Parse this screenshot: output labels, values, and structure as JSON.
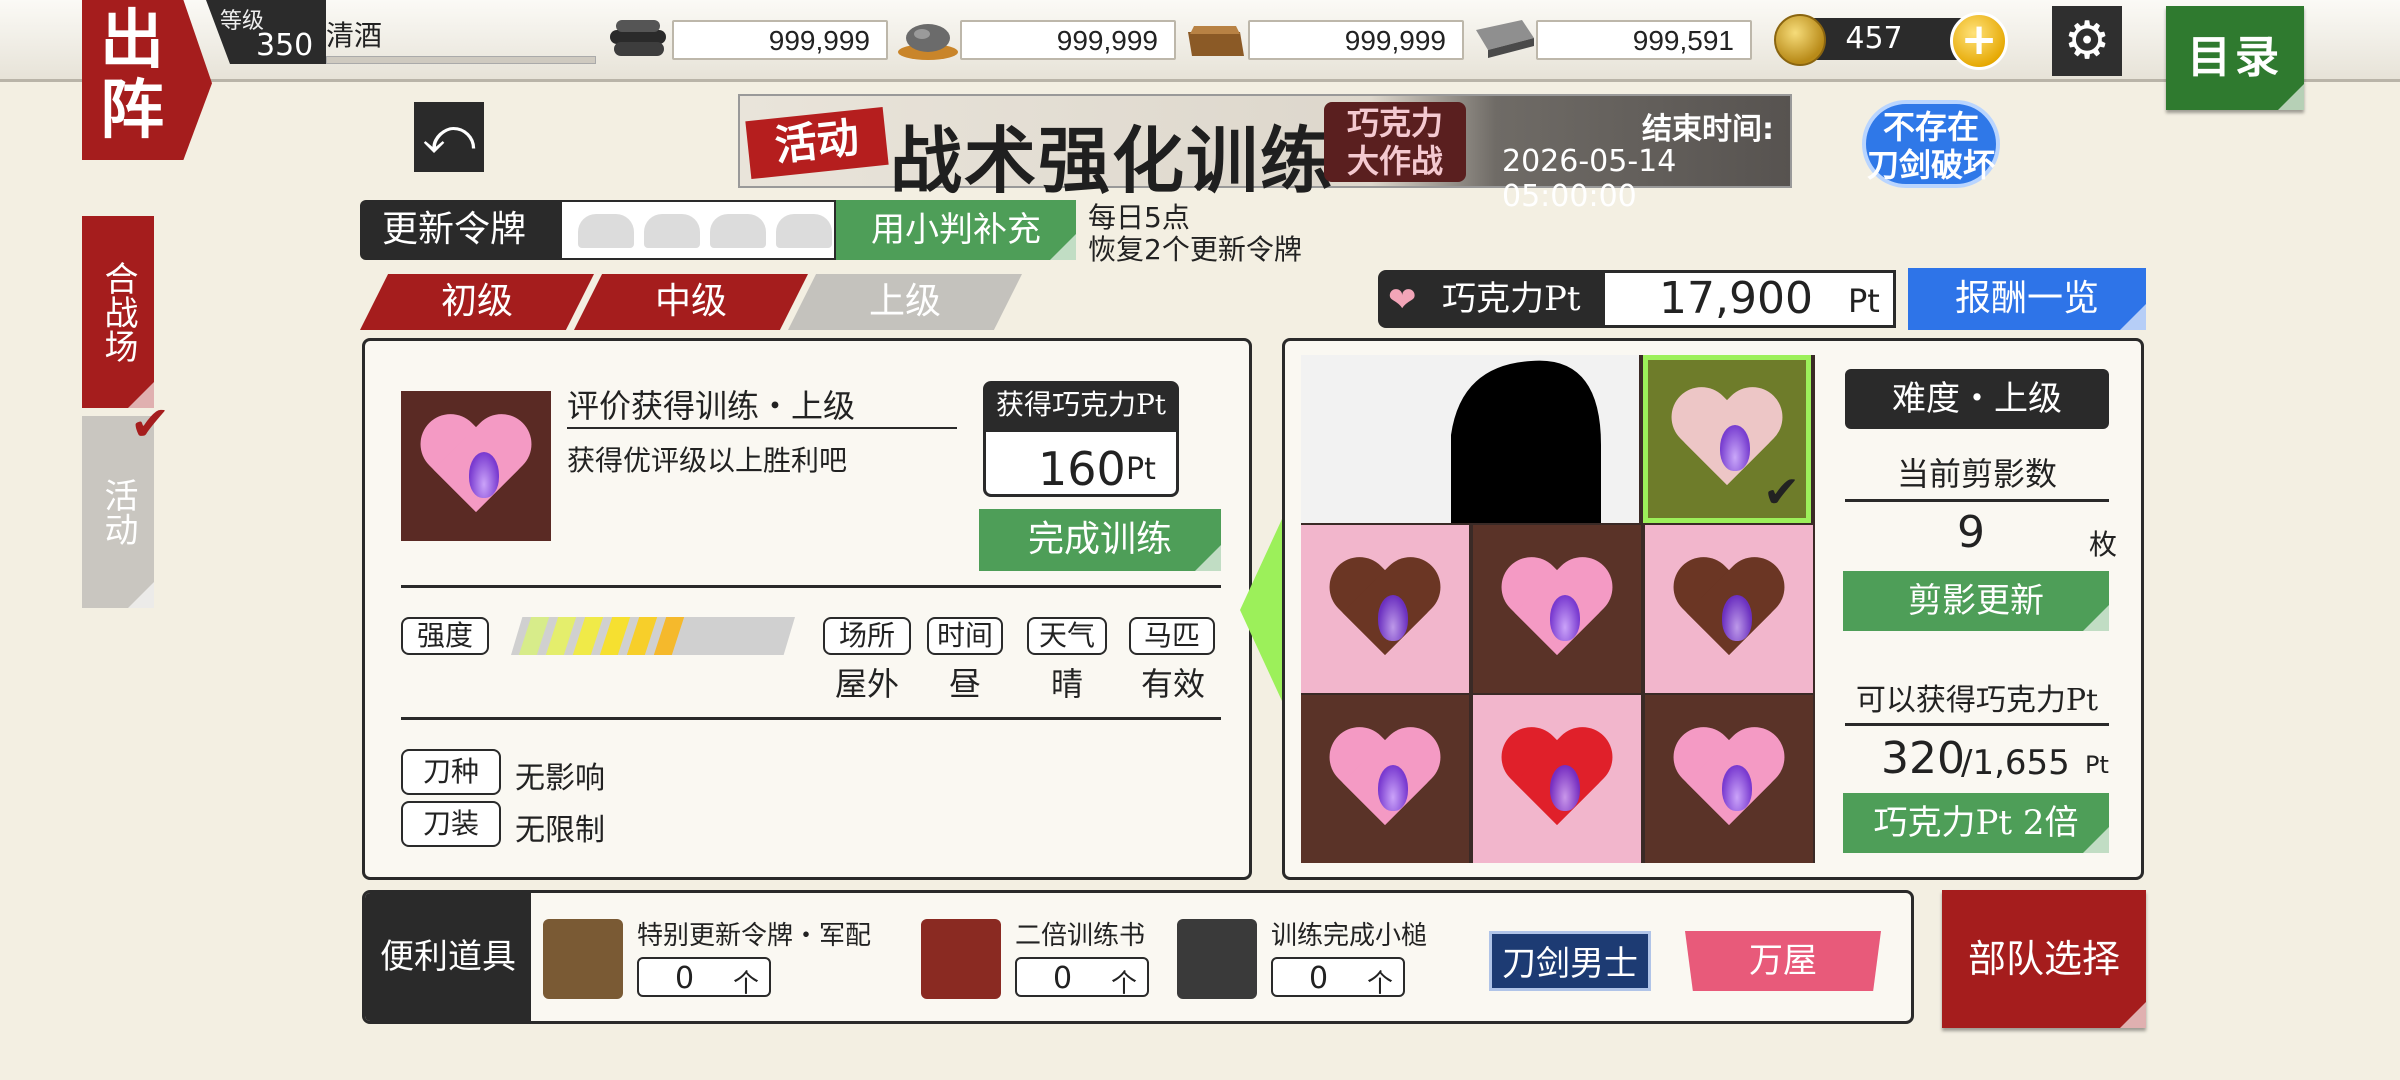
{
  "topbar": {
    "sortie_label": "出阵",
    "level_label": "等级",
    "level_value": "350",
    "player_name": "清酒",
    "resources": [
      {
        "icon": "charcoal-icon",
        "value": "999,999"
      },
      {
        "icon": "tamahagane-icon",
        "value": "999,999"
      },
      {
        "icon": "cooling-material-icon",
        "value": "999,999"
      },
      {
        "icon": "whetstone-icon",
        "value": "999,591"
      }
    ],
    "koban_value": "457",
    "plus_label": "+",
    "gear_label": "⚙",
    "menu_label": "目录"
  },
  "side_tabs": {
    "battle": "合战场",
    "event": "活动",
    "check": "✔"
  },
  "back_label": "⤺",
  "banner": {
    "tag": "活动",
    "title": "战术强化训练",
    "subtitle_line1": "巧克力",
    "subtitle_line2": "大作战",
    "end_label": "结束时间:",
    "end_time": "2026-05-14 05:00:00"
  },
  "badge_nobreak_line1": "不存在",
  "badge_nobreak_line2": "刀剑破坏",
  "tokens": {
    "label": "更新令牌",
    "refill_label": "用小判补充",
    "note1": "每日5点",
    "note2": "恢复2个更新令牌"
  },
  "difficulty_tabs": [
    {
      "label": "初级",
      "color": "#a51d1d"
    },
    {
      "label": "中级",
      "color": "#a51d1d"
    },
    {
      "label": "上级",
      "color": "#c4c2bd"
    }
  ],
  "points": {
    "label": "巧克力Pt",
    "value": "17,900",
    "unit": "Pt",
    "reward_label": "报酬一览"
  },
  "mission": {
    "title": "评价获得训练・上级",
    "desc": "获得优评级以上胜利吧",
    "gain_label": "获得巧克力Pt",
    "gain_value": "160",
    "gain_unit": "Pt",
    "complete_label": "完成训练",
    "intensity_label": "强度",
    "intensity_level": "6/10",
    "conditions": [
      {
        "label": "场所",
        "value": "屋外"
      },
      {
        "label": "时间",
        "value": "昼"
      },
      {
        "label": "天气",
        "value": "晴"
      },
      {
        "label": "马匹",
        "value": "有效"
      }
    ],
    "rules": [
      {
        "label": "刀种",
        "value": "无影响"
      },
      {
        "label": "刀装",
        "value": "无限制"
      }
    ]
  },
  "shadow": {
    "difficulty": "难度・上级",
    "count_label": "当前剪影数",
    "count_value": "9",
    "count_unit": "枚",
    "refresh_label": "剪影更新",
    "obtainable_label": "可以获得巧克力Pt",
    "obtainable_current": "320",
    "obtainable_total": "/1,655",
    "obtainable_unit": "Pt",
    "double_label": "巧克力Pt 2倍",
    "cell_check": "✔"
  },
  "items": {
    "label": "便利道具",
    "list": [
      {
        "name": "特别更新令牌・军配",
        "count": "0",
        "unit": "个"
      },
      {
        "name": "二倍训练书",
        "count": "0",
        "unit": "个"
      },
      {
        "name": "训练完成小槌",
        "count": "0",
        "unit": "个"
      }
    ],
    "swords_label": "刀剑男士",
    "yorozuya_label": "万屋"
  },
  "squad_label": "部队选择"
}
